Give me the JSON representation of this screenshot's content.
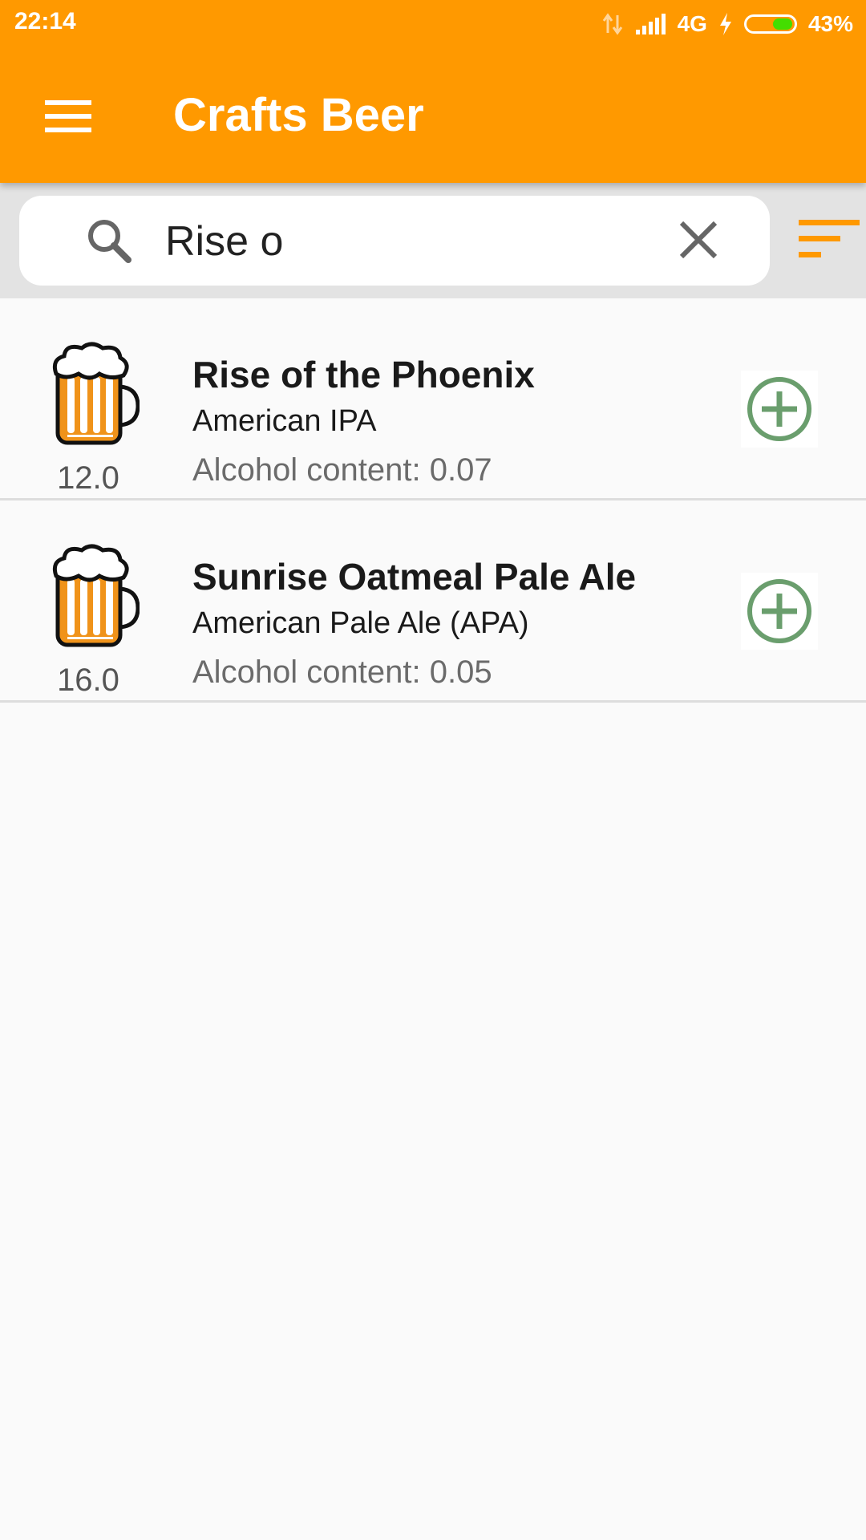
{
  "status_bar": {
    "time": "22:14",
    "network": "4G",
    "battery_percent": "43%",
    "battery_level": 0.43
  },
  "app_bar": {
    "title": "Crafts Beer",
    "menu_icon": "hamburger-menu-icon"
  },
  "search": {
    "value": "Rise o",
    "search_icon": "search-icon",
    "clear_icon": "close-icon",
    "sort_icon": "sort-icon"
  },
  "colors": {
    "primary": "#ff9900",
    "add_green": "#6a9e6d",
    "search_area_bg": "#e3e3e3"
  },
  "beers": [
    {
      "name": "Rise of the Phoenix",
      "style": "American IPA",
      "abv": "Alcohol content: 0.07",
      "volume": "12.0",
      "icon": "beer-mug-icon",
      "action_icon": "add-circle-icon"
    },
    {
      "name": "Sunrise Oatmeal Pale Ale",
      "style": "American Pale Ale (APA)",
      "abv": "Alcohol content: 0.05",
      "volume": "16.0",
      "icon": "beer-mug-icon",
      "action_icon": "add-circle-icon"
    }
  ]
}
